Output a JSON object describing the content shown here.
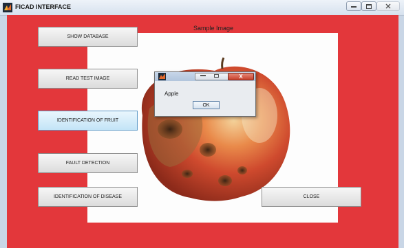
{
  "window": {
    "title": "FICAD INTERFACE",
    "controls": [
      "minimize",
      "maximize",
      "close"
    ]
  },
  "panel": {
    "sample_label": "Sample Image",
    "background_color": "#e3373b"
  },
  "buttons": {
    "show_database": "SHOW DATABASE",
    "read_test_image": "READ TEST IMAGE",
    "identification_of_fruit": "IDENTIFICATION OF FRUIT",
    "fault_detection": "FAULT DETECTION",
    "identification_of_disease": "IDENTIFICATION OF DISEASE",
    "close": "CLOSE"
  },
  "dialog": {
    "message": "Apple",
    "ok_label": "OK",
    "close_glyph": "X"
  },
  "icons": {
    "app": "matlab-icon",
    "dialog": "matlab-icon"
  }
}
